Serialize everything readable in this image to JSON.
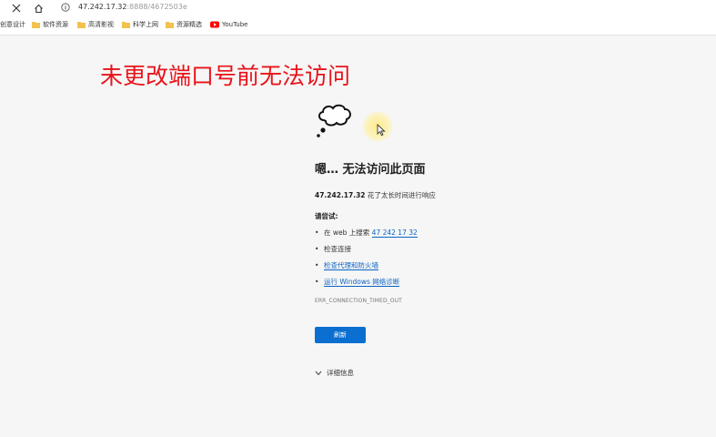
{
  "browser": {
    "url_host": "47.242.17.32",
    "url_rest": ":8888/4672503e",
    "bookmarks": [
      {
        "label": "创意设计",
        "icon": "none"
      },
      {
        "label": "软件资源",
        "icon": "folder-icon"
      },
      {
        "label": "高清影视",
        "icon": "folder-icon"
      },
      {
        "label": "科学上网",
        "icon": "folder-icon"
      },
      {
        "label": "资源精选",
        "icon": "folder-icon"
      },
      {
        "label": "YouTube",
        "icon": "youtube-icon"
      }
    ]
  },
  "annotation": "未更改端口号前无法访问",
  "error_page": {
    "heading": "嗯… 无法访问此页面",
    "host": "47.242.17.32",
    "desc_suffix": " 花了太长时间进行响应",
    "try_label": "请尝试:",
    "suggestions": {
      "search_prefix": "在 web 上搜索 ",
      "search_link": "47 242 17 32",
      "check_connection": "检查连接",
      "check_proxy": "检查代理和防火墙",
      "run_diagnostics": "运行 Windows 网络诊断"
    },
    "error_code": "ERR_CONNECTION_TIMED_OUT",
    "refresh_label": "刷新",
    "details_label": "详细信息"
  },
  "colors": {
    "annotation": "#e8131a",
    "link": "#0b63c5",
    "button": "#0a6fd1",
    "folder": "#f2c14e",
    "youtube": "#ff0000"
  }
}
